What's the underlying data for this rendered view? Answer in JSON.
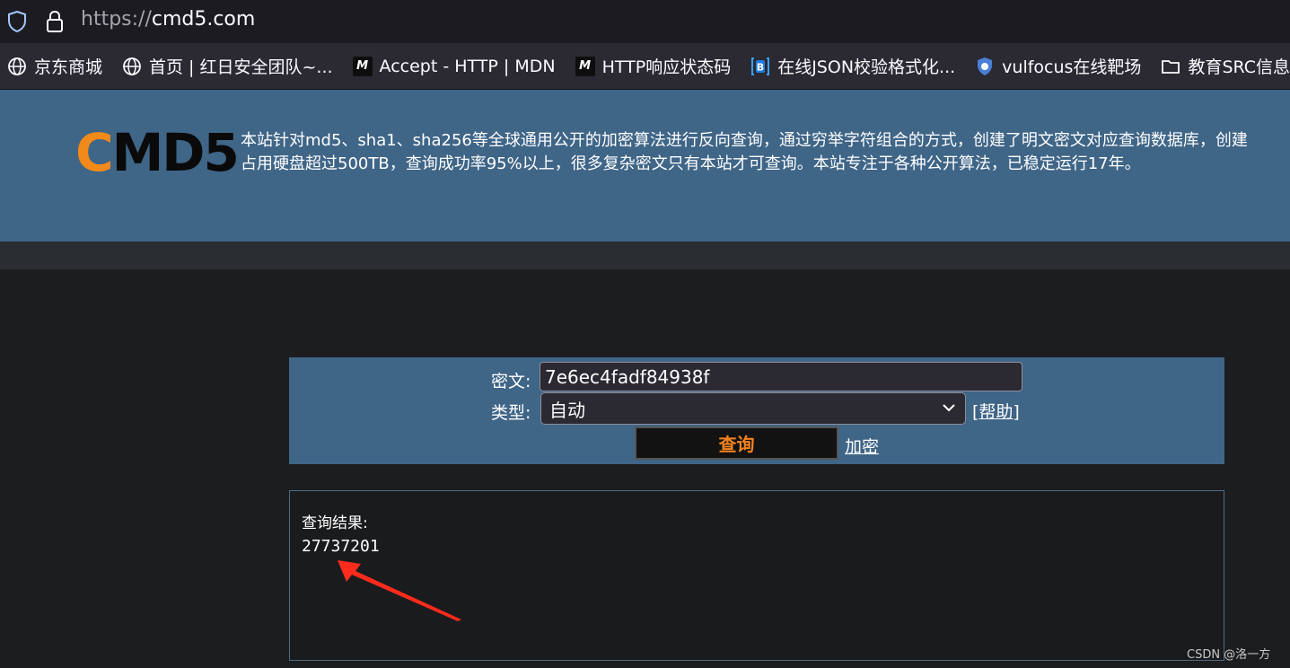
{
  "browser": {
    "url_protocol": "https://",
    "url_host": "cmd5.com"
  },
  "bookmarks": [
    {
      "label": "京东商城",
      "icon": "globe-icon"
    },
    {
      "label": "首页 | 红日安全团队~...",
      "icon": "globe-icon"
    },
    {
      "label": "Accept - HTTP | MDN",
      "icon": "mdn-icon"
    },
    {
      "label": "HTTP响应状态码",
      "icon": "mdn-icon"
    },
    {
      "label": "在线JSON校验格式化...",
      "icon": "bejson-icon"
    },
    {
      "label": "vulfocus在线靶场",
      "icon": "bug-shield-icon"
    },
    {
      "label": "教育SRC信息搜",
      "icon": "folder-icon"
    }
  ],
  "header": {
    "logo_c": "C",
    "logo_rest": "MD5",
    "intro_line1": "本站针对md5、sha1、sha256等全球通用公开的加密算法进行反向查询，通过穷举字符组合的方式，创建了明文密文对应查询数据库，创建",
    "intro_line2": "占用硬盘超过500TB，查询成功率95%以上，很多复杂密文只有本站才可查询。本站专注于各种公开算法，已稳定运行17年。"
  },
  "form": {
    "cipher_label": "密文:",
    "cipher_value": "7e6ec4fadf84938f",
    "type_label": "类型:",
    "type_value": "自动",
    "help_label": "[帮助]",
    "query_button": "查询",
    "encrypt_link": "加密"
  },
  "result": {
    "label": "查询结果:",
    "value": "27737201"
  },
  "watermark": "CSDN @洛一方",
  "colors": {
    "banner": "#3f6587",
    "logo_accent": "#f28a1a",
    "query_text": "#f5821f",
    "arrow": "#ff2b1c"
  }
}
